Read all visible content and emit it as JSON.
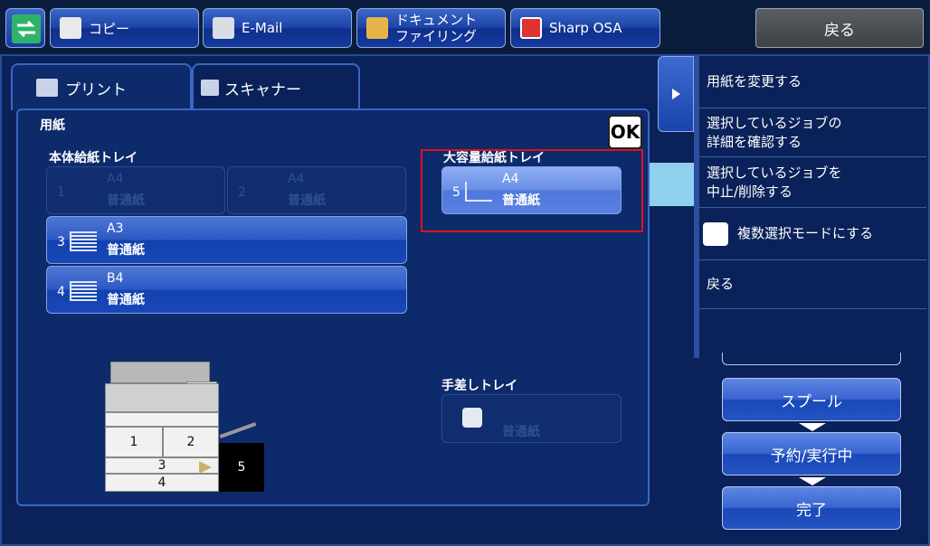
{
  "topbar": {
    "copy_label": "コピー",
    "email_label": "E-Mail",
    "docfiling_line1": "ドキュメント",
    "docfiling_line2": "ファイリング",
    "osa_label": "Sharp OSA",
    "back_label": "戻る"
  },
  "tabs": [
    {
      "label": "プリント"
    },
    {
      "label": "スキャナー"
    }
  ],
  "panel": {
    "title": "用紙",
    "ok_label": "OK",
    "main_tray_label": "本体給紙トレイ",
    "lcc_label": "大容量給紙トレイ",
    "bypass_label": "手差しトレイ"
  },
  "trays": [
    {
      "num": "1",
      "size": "A4",
      "type": "普通紙"
    },
    {
      "num": "2",
      "size": "A4",
      "type": "普通紙"
    },
    {
      "num": "3",
      "size": "A3",
      "type": "普通紙"
    },
    {
      "num": "4",
      "size": "B4",
      "type": "普通紙"
    },
    {
      "num": "5",
      "size": "A4",
      "type": "普通紙"
    }
  ],
  "bypass_type": "普通紙",
  "machine": {
    "tray1": "1",
    "tray2": "2",
    "tray3": "3",
    "tray4": "4",
    "tray5": "5"
  },
  "menu": {
    "change_paper": "用紙を変更する",
    "detail_line1": "選択しているジョブの",
    "detail_line2": "詳細を確認する",
    "cancel_line1": "選択しているジョブを",
    "cancel_line2": "中止/削除する",
    "multi_select": "複数選択モードにする",
    "back": "戻る"
  },
  "status": {
    "spool": "スプール",
    "queue": "予約/実行中",
    "complete": "完了"
  },
  "colors": {
    "accent": "#2d59c4",
    "highlight": "#e0101a"
  }
}
